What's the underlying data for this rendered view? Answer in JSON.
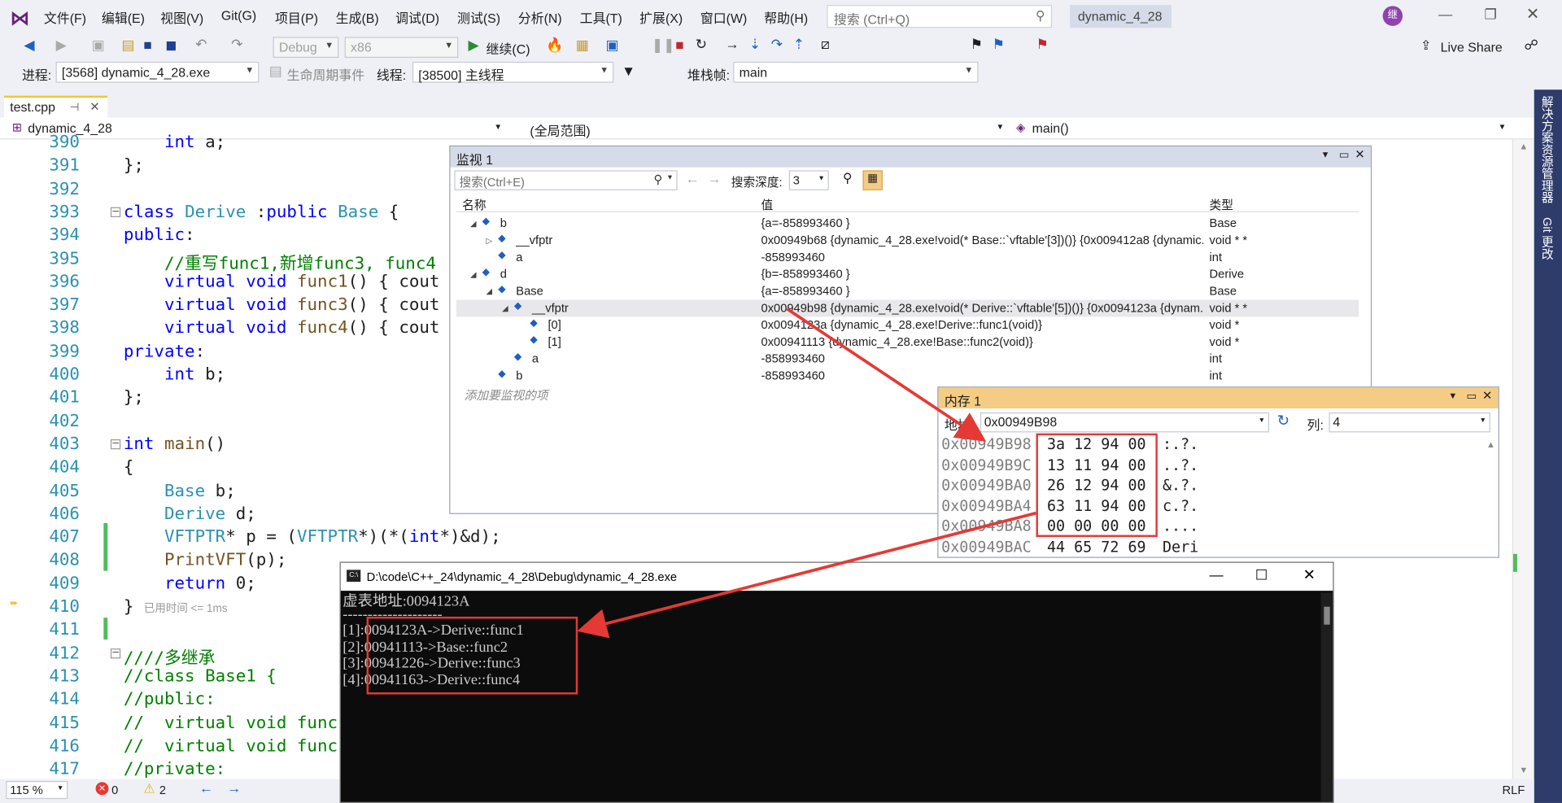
{
  "menu": {
    "items": [
      "文件(F)",
      "编辑(E)",
      "视图(V)",
      "Git(G)",
      "项目(P)",
      "生成(B)",
      "调试(D)",
      "测试(S)",
      "分析(N)",
      "工具(T)",
      "扩展(X)",
      "窗口(W)",
      "帮助(H)"
    ],
    "search_placeholder": "搜索 (Ctrl+Q)",
    "solution_name": "dynamic_4_28",
    "live_share": "Live Share"
  },
  "toolbar": {
    "config": "Debug",
    "platform": "x86",
    "continue_label": "继续(C)",
    "process_label": "进程:",
    "process_value": "[3568] dynamic_4_28.exe",
    "lifecycle_label": "生命周期事件",
    "thread_label": "线程:",
    "thread_value": "[38500] 主线程",
    "stackframe_label": "堆栈帧:",
    "stackframe_value": "main"
  },
  "tabs": {
    "file_tab": "test.cpp"
  },
  "navbar": {
    "project": "dynamic_4_28",
    "scope": "(全局范围)",
    "function": "main()"
  },
  "editor": {
    "lines": [
      {
        "n": "390",
        "html": "    <span class='kw'>int</span> a;"
      },
      {
        "n": "391",
        "html": "};"
      },
      {
        "n": "392",
        "html": ""
      },
      {
        "n": "393",
        "html": "<span class='kw'>class</span> <span class='ty'>Derive</span> :<span class='kw'>public</span> <span class='ty'>Base</span> {"
      },
      {
        "n": "394",
        "html": "<span class='kw'>public</span>:"
      },
      {
        "n": "395",
        "html": "    <span class='cm'>//重写func1,新增func3, func4</span>"
      },
      {
        "n": "396",
        "html": "    <span class='kw'>virtual</span> <span class='kw'>void</span> <span class='fn'>func1</span>() { cout"
      },
      {
        "n": "397",
        "html": "    <span class='kw'>virtual</span> <span class='kw'>void</span> <span class='fn'>func3</span>() { cout"
      },
      {
        "n": "398",
        "html": "    <span class='kw'>virtual</span> <span class='kw'>void</span> <span class='fn'>func4</span>() { cout"
      },
      {
        "n": "399",
        "html": "<span class='kw'>private</span>:"
      },
      {
        "n": "400",
        "html": "    <span class='kw'>int</span> b;"
      },
      {
        "n": "401",
        "html": "};"
      },
      {
        "n": "402",
        "html": ""
      },
      {
        "n": "403",
        "html": "<span class='kw'>int</span> <span class='fn'>main</span>()"
      },
      {
        "n": "404",
        "html": "{"
      },
      {
        "n": "405",
        "html": "    <span class='ty'>Base</span> b;"
      },
      {
        "n": "406",
        "html": "    <span class='ty'>Derive</span> d;"
      },
      {
        "n": "407",
        "html": "    <span class='ty'>VFTPTR</span>* p = (<span class='ty'>VFTPTR</span>*)(*(<span class='kw'>int</span>*)&amp;d);"
      },
      {
        "n": "408",
        "html": "    <span class='fn'>PrintVFT</span>(p);"
      },
      {
        "n": "409",
        "html": "    <span class='kw'>return</span> 0;"
      },
      {
        "n": "410",
        "html": "} <span style='font-family:Liberation Sans,sans-serif;font-size:11px;color:#999'>已用时间 &lt;= 1ms</span>"
      },
      {
        "n": "411",
        "html": ""
      },
      {
        "n": "412",
        "html": "<span class='cm'>////多继承</span>"
      },
      {
        "n": "413",
        "html": "<span class='cm'>//class Base1 {</span>"
      },
      {
        "n": "414",
        "html": "<span class='cm'>//public:</span>"
      },
      {
        "n": "415",
        "html": "<span class='cm'>//  virtual void func</span>"
      },
      {
        "n": "416",
        "html": "<span class='cm'>//  virtual void func</span>"
      },
      {
        "n": "417",
        "html": "<span class='cm'>//private:</span>"
      }
    ]
  },
  "watch": {
    "title": "监视 1",
    "search_placeholder": "搜索(Ctrl+E)",
    "depth_label": "搜索深度:",
    "depth_value": "3",
    "col_name": "名称",
    "col_value": "值",
    "col_type": "类型",
    "add_hint": "添加要监视的项",
    "rows": [
      {
        "name": "b",
        "indent": 0,
        "exp": "◢",
        "value": "{a=-858993460 }",
        "type": "Base"
      },
      {
        "name": "__vfptr",
        "indent": 1,
        "exp": "▷",
        "value": "0x00949b68 {dynamic_4_28.exe!void(* Base::`vftable'[3])()} {0x009412a8 {dynamic...",
        "type": "void * *"
      },
      {
        "name": "a",
        "indent": 1,
        "exp": "",
        "value": "-858993460",
        "type": "int"
      },
      {
        "name": "d",
        "indent": 0,
        "exp": "◢",
        "value": "{b=-858993460 }",
        "type": "Derive"
      },
      {
        "name": "Base",
        "indent": 1,
        "exp": "◢",
        "value": "{a=-858993460 }",
        "type": "Base"
      },
      {
        "name": "__vfptr",
        "indent": 2,
        "exp": "◢",
        "value": "0x00949b98 {dynamic_4_28.exe!void(* Derive::`vftable'[5])()} {0x0094123a {dynam...",
        "type": "void * *"
      },
      {
        "name": "[0]",
        "indent": 3,
        "exp": "",
        "value": "0x0094123a {dynamic_4_28.exe!Derive::func1(void)}",
        "type": "void *"
      },
      {
        "name": "[1]",
        "indent": 3,
        "exp": "",
        "value": "0x00941113 {dynamic_4_28.exe!Base::func2(void)}",
        "type": "void *"
      },
      {
        "name": "a",
        "indent": 2,
        "exp": "",
        "value": "-858993460",
        "type": "int"
      },
      {
        "name": "b",
        "indent": 1,
        "exp": "",
        "value": "-858993460",
        "type": "int"
      }
    ]
  },
  "memory": {
    "title": "内存 1",
    "address_label": "地址:",
    "address_value": "0x00949B98",
    "columns_label": "列:",
    "columns_value": "4",
    "rows": [
      {
        "addr": "0x00949B98",
        "bytes": "3a 12 94 00",
        "ascii": ":.?."
      },
      {
        "addr": "0x00949B9C",
        "bytes": "13 11 94 00",
        "ascii": "..?."
      },
      {
        "addr": "0x00949BA0",
        "bytes": "26 12 94 00",
        "ascii": "&.?."
      },
      {
        "addr": "0x00949BA4",
        "bytes": "63 11 94 00",
        "ascii": "c.?."
      },
      {
        "addr": "0x00949BA8",
        "bytes": "00 00 00 00",
        "ascii": "...."
      },
      {
        "addr": "0x00949BAC",
        "bytes": "44 65 72 69",
        "ascii": "Deri"
      }
    ]
  },
  "console": {
    "title": "D:\\code\\C++_24\\dynamic_4_28\\Debug\\dynamic_4_28.exe",
    "lines": [
      "虚表地址:0094123A",
      "--------------------",
      "[1]:0094123A->Derive::func1",
      "[2]:00941113->Base::func2",
      "[3]:00941226->Derive::func3",
      "[4]:00941163->Derive::func4"
    ]
  },
  "status": {
    "zoom": "115 %",
    "errors": "0",
    "warnings": "2",
    "encoding": "RLF"
  },
  "rightdock": {
    "items": [
      "解决方案资源管理器",
      "Git 更改"
    ]
  },
  "colors": {
    "accent_red": "#e53935",
    "titlebar_blue": "#d6dbe9",
    "dock_blue": "#2e3c6c"
  }
}
